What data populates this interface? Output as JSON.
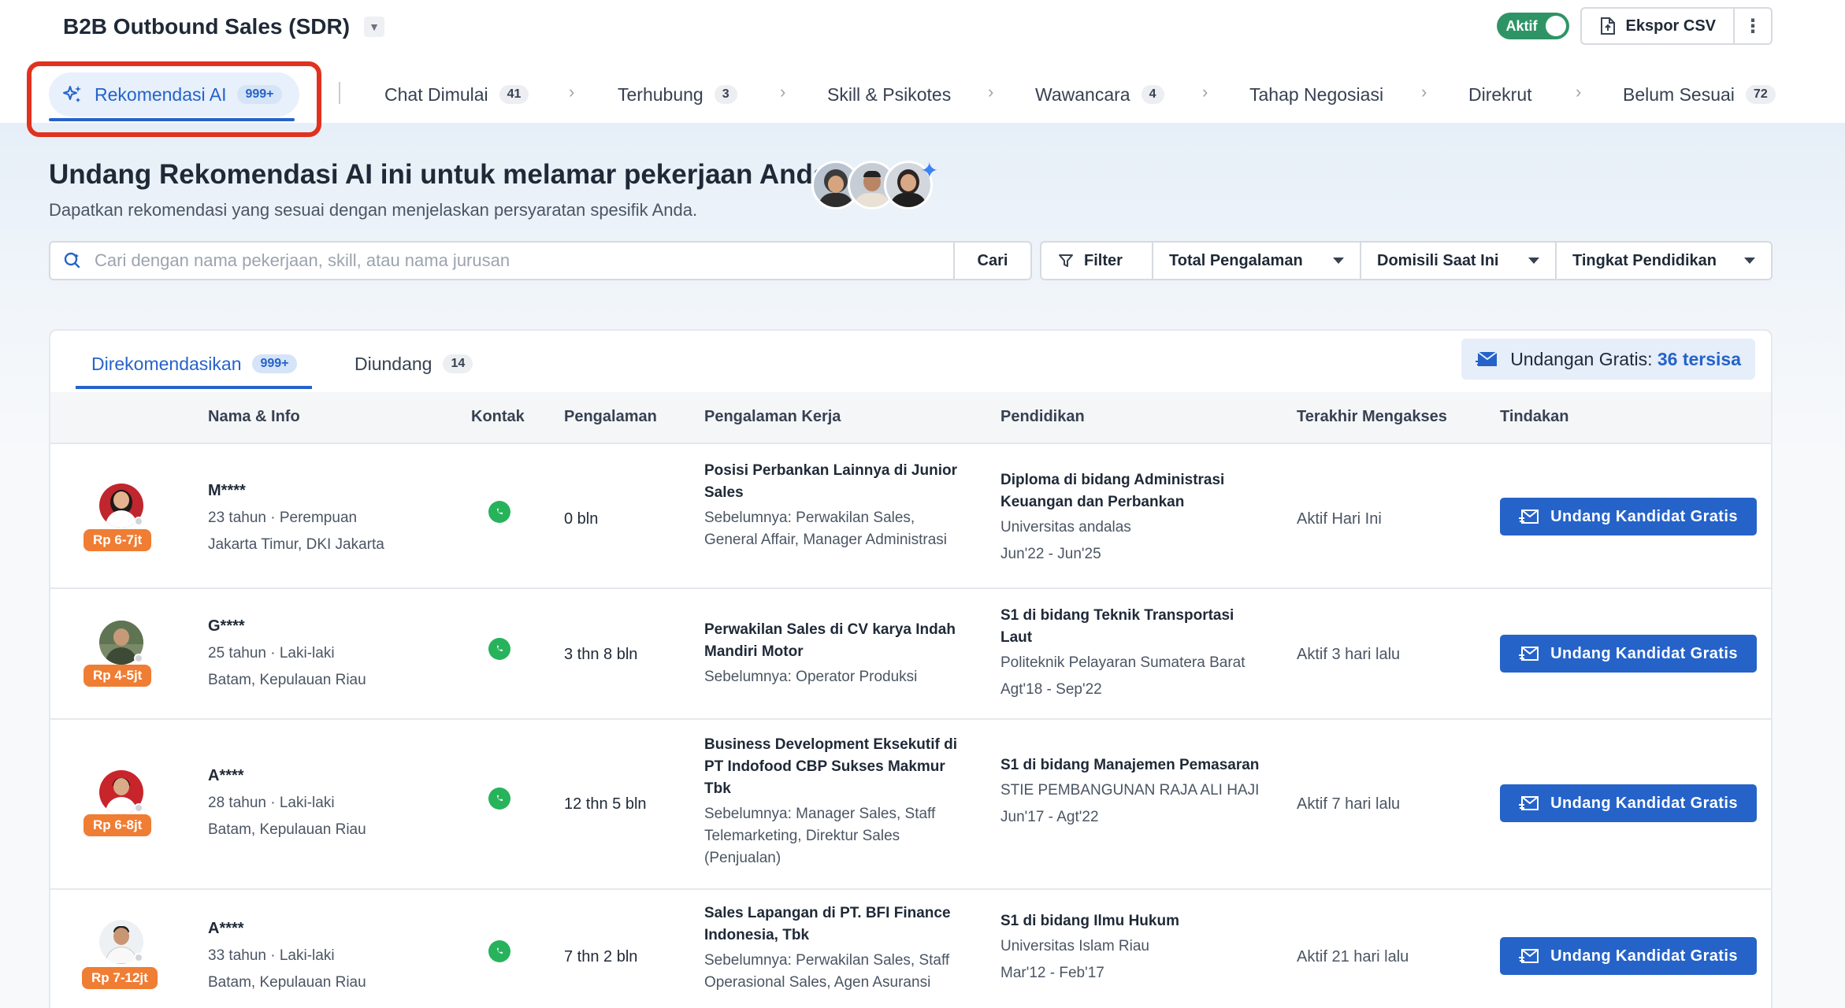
{
  "header": {
    "job_title": "B2B Outbound Sales (SDR)",
    "status_label": "Aktif",
    "export_label": "Ekspor CSV"
  },
  "stages": [
    {
      "label": "Rekomendasi AI",
      "count": "999+"
    },
    {
      "label": "Chat Dimulai",
      "count": "41"
    },
    {
      "label": "Terhubung",
      "count": "3"
    },
    {
      "label": "Skill & Psikotes",
      "count": ""
    },
    {
      "label": "Wawancara",
      "count": "4"
    },
    {
      "label": "Tahap Negosiasi",
      "count": ""
    },
    {
      "label": "Direkrut",
      "count": ""
    },
    {
      "label": "Belum Sesuai",
      "count": "72"
    }
  ],
  "hero": {
    "title": "Undang Rekomendasi AI ini untuk melamar pekerjaan Anda",
    "subtitle": "Dapatkan rekomendasi yang sesuai dengan menjelaskan persyaratan spesifik Anda."
  },
  "search": {
    "placeholder": "Cari dengan nama pekerjaan, skill, atau nama jurusan",
    "value": "",
    "button_label": "Cari"
  },
  "filters": {
    "filter_label": "Filter",
    "dropdowns": [
      "Total Pengalaman",
      "Domisili Saat Ini",
      "Tingkat Pendidikan"
    ]
  },
  "card_tabs": [
    {
      "label": "Direkomendasikan",
      "count": "999+"
    },
    {
      "label": "Diundang",
      "count": "14"
    }
  ],
  "invite_quota": {
    "label": "Undangan Gratis:",
    "value": "36 tersisa"
  },
  "table": {
    "headers": [
      "Nama & Info",
      "Kontak",
      "Pengalaman",
      "Pengalaman Kerja",
      "Pendidikan",
      "Terakhir Mengakses",
      "Tindakan"
    ],
    "invite_label": "Undang Kandidat Gratis",
    "rows": [
      {
        "salary": "Rp 6-7jt",
        "name": "M****",
        "age_gender": "23 tahun · Perempuan",
        "location": "Jakarta Timur, DKI Jakarta",
        "experience": "0 bln",
        "job_title": "Posisi Perbankan Lainnya di Junior Sales",
        "job_prev": "Sebelumnya: Perwakilan Sales, General Affair, Manager Administrasi",
        "edu_title": "Diploma di bidang Administrasi Keuangan dan Perbankan",
        "edu_school": "Universitas andalas",
        "edu_period": "Jun'22 - Jun'25",
        "last_active": "Aktif Hari Ini"
      },
      {
        "salary": "Rp 4-5jt",
        "name": "G****",
        "age_gender": "25 tahun · Laki-laki",
        "location": "Batam, Kepulauan Riau",
        "experience": "3 thn 8 bln",
        "job_title": "Perwakilan Sales di CV karya Indah Mandiri Motor",
        "job_prev": "Sebelumnya: Operator Produksi",
        "edu_title": "S1 di bidang Teknik Transportasi Laut",
        "edu_school": "Politeknik Pelayaran Sumatera Barat",
        "edu_period": "Agt'18 - Sep'22",
        "last_active": "Aktif 3 hari lalu"
      },
      {
        "salary": "Rp 6-8jt",
        "name": "A****",
        "age_gender": "28 tahun · Laki-laki",
        "location": "Batam, Kepulauan Riau",
        "experience": "12 thn 5 bln",
        "job_title": "Business Development Eksekutif di PT Indofood CBP Sukses Makmur Tbk",
        "job_prev": "Sebelumnya: Manager Sales, Staff Telemarketing, Direktur Sales (Penjualan)",
        "edu_title": "S1 di bidang Manajemen Pemasaran",
        "edu_school": "STIE PEMBANGUNAN RAJA ALI HAJI",
        "edu_period": "Jun'17 - Agt'22",
        "last_active": "Aktif 7 hari lalu"
      },
      {
        "salary": "Rp 7-12jt",
        "name": "A****",
        "age_gender": "33 tahun · Laki-laki",
        "location": "Batam, Kepulauan Riau",
        "experience": "7 thn 2 bln",
        "job_title": "Sales Lapangan di PT. BFI Finance Indonesia, Tbk",
        "job_prev": "Sebelumnya: Perwakilan Sales, Staff Operasional Sales, Agen Asuransi",
        "edu_title": "S1 di bidang Ilmu Hukum",
        "edu_school": "Universitas Islam Riau",
        "edu_period": "Mar'12 - Feb'17",
        "last_active": "Aktif 21 hari lalu"
      }
    ]
  },
  "colors": {
    "primary": "#2563c9",
    "success": "#2e9466",
    "salary_badge": "#ef7d33",
    "highlight": "#e0321f",
    "whatsapp": "#27b35b"
  }
}
